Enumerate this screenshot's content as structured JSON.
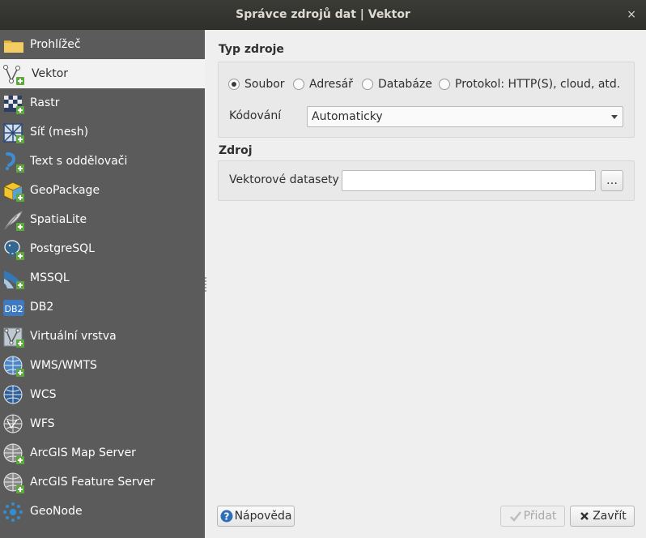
{
  "window": {
    "title": "Správce zdrojů dat | Vektor",
    "close_glyph": "×"
  },
  "sidebar": {
    "items": [
      {
        "label": "Prohlížeč",
        "icon": "folder-icon"
      },
      {
        "label": "Vektor",
        "icon": "vector-icon",
        "selected": true
      },
      {
        "label": "Rastr",
        "icon": "raster-icon"
      },
      {
        "label": "Síť (mesh)",
        "icon": "mesh-icon"
      },
      {
        "label": "Text s oddělovači",
        "icon": "delimited-text-icon"
      },
      {
        "label": "GeoPackage",
        "icon": "geopackage-icon"
      },
      {
        "label": "SpatiaLite",
        "icon": "spatialite-icon"
      },
      {
        "label": "PostgreSQL",
        "icon": "postgresql-icon"
      },
      {
        "label": "MSSQL",
        "icon": "mssql-icon"
      },
      {
        "label": "DB2",
        "icon": "db2-icon"
      },
      {
        "label": "Virtuální vrstva",
        "icon": "virtual-layer-icon"
      },
      {
        "label": "WMS/WMTS",
        "icon": "wms-icon"
      },
      {
        "label": "WCS",
        "icon": "wcs-icon"
      },
      {
        "label": "WFS",
        "icon": "wfs-icon"
      },
      {
        "label": "ArcGIS Map Server",
        "icon": "arcgis-map-server-icon"
      },
      {
        "label": "ArcGIS Feature Server",
        "icon": "arcgis-feature-server-icon"
      },
      {
        "label": "GeoNode",
        "icon": "geonode-icon"
      }
    ],
    "db2_text": "DB2"
  },
  "source_type": {
    "title": "Typ zdroje",
    "options": [
      {
        "label": "Soubor",
        "checked": true
      },
      {
        "label": "Adresář",
        "checked": false
      },
      {
        "label": "Databáze",
        "checked": false
      },
      {
        "label": "Protokol: HTTP(S), cloud, atd.",
        "checked": false
      }
    ],
    "encoding_label": "Kódování",
    "encoding_value": "Automaticky"
  },
  "source": {
    "title": "Zdroj",
    "datasets_label": "Vektorové datasety",
    "datasets_value": "",
    "browse_label": "…"
  },
  "footer": {
    "help_label": "Nápověda",
    "add_label": "Přidat",
    "close_label": "Zavřít"
  },
  "colors": {
    "sidebar_bg": "#5b5b5b",
    "titlebar_bg": "#33332f",
    "qgis_green": "#5fa83b",
    "accent_blue": "#2f7fc1"
  }
}
